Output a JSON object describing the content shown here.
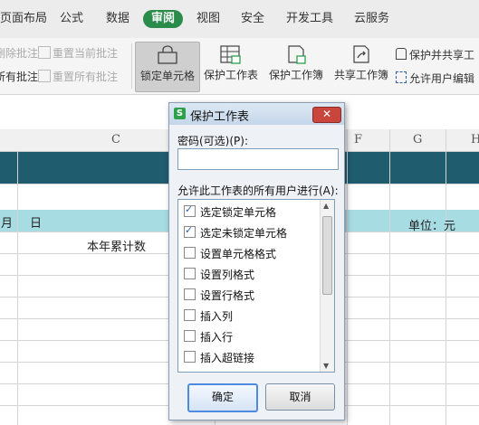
{
  "menu": {
    "items": [
      "页面布局",
      "公式",
      "数据",
      "审阅",
      "视图",
      "安全",
      "开发工具",
      "云服务"
    ],
    "active": "审阅"
  },
  "ribbon": {
    "small": {
      "delete_comment": "删除批注",
      "reset_current_comment": "重置当前批注",
      "show_all_comments": "所有批注",
      "reset_all_comments": "重置所有批注"
    },
    "big": {
      "lock_cell": "锁定单元格",
      "protect_sheet": "保护工作表",
      "protect_workbook": "保护工作簿",
      "share_workbook": "共享工作簿"
    },
    "right": {
      "protect_and_share": "保护并共享工",
      "allow_users_edit": "允许用户编辑"
    }
  },
  "sheet": {
    "columns": [
      "C",
      "F",
      "G",
      "H"
    ],
    "cells": {
      "month": "月",
      "day": "日",
      "unit": "单位：元",
      "cumulative": "本年累计数"
    }
  },
  "dialog": {
    "title": "保护工作表",
    "logo": "S",
    "close": "✕",
    "password_label": "密码(可选)(P):",
    "password_value": "",
    "allow_label": "允许此工作表的所有用户进行(A):",
    "options": [
      {
        "label": "选定锁定单元格",
        "checked": true
      },
      {
        "label": "选定未锁定单元格",
        "checked": true
      },
      {
        "label": "设置单元格格式",
        "checked": false
      },
      {
        "label": "设置列格式",
        "checked": false
      },
      {
        "label": "设置行格式",
        "checked": false
      },
      {
        "label": "插入列",
        "checked": false
      },
      {
        "label": "插入行",
        "checked": false
      },
      {
        "label": "插入超链接",
        "checked": false
      }
    ],
    "ok": "确定",
    "cancel": "取消"
  }
}
